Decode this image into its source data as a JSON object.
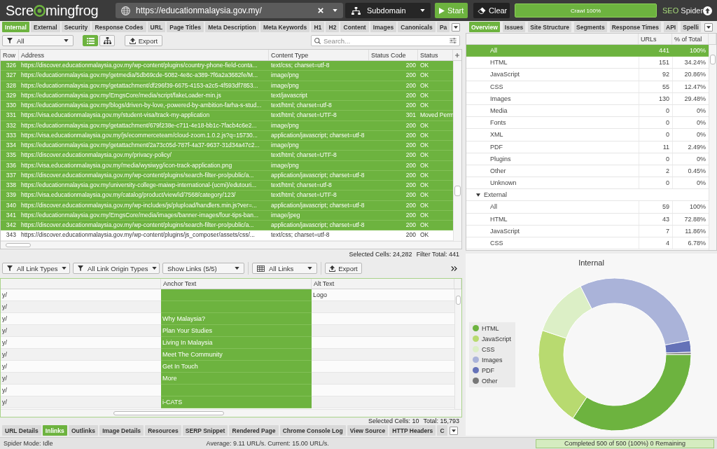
{
  "top_bar": {
    "logo": [
      "Scre",
      "mingfrog"
    ],
    "url_field": {
      "value": "https://educationmalaysia.gov.my/"
    },
    "mode_dropdown": {
      "value": "Subdomain"
    },
    "buttons": [
      {
        "kind": "start",
        "label": "Start"
      },
      {
        "kind": "clear",
        "label": "Clear"
      }
    ],
    "crawl_progress": {
      "label": "Crawl 100%",
      "level": 1
    },
    "product": [
      "SEO",
      "Spider"
    ]
  },
  "left_tabs": [
    {
      "label": "Internal",
      "selected": true
    },
    {
      "label": "External",
      "selected": false
    },
    {
      "label": "Security",
      "selected": false
    },
    {
      "label": "Response Codes",
      "selected": false
    },
    {
      "label": "URL",
      "selected": false
    },
    {
      "label": "Page Titles",
      "selected": false
    },
    {
      "label": "Meta Description",
      "selected": false
    },
    {
      "label": "Meta Keywords",
      "selected": false
    },
    {
      "label": "H1",
      "selected": false
    },
    {
      "label": "H2",
      "selected": false
    },
    {
      "label": "Content",
      "selected": false
    },
    {
      "label": "Images",
      "selected": false
    },
    {
      "label": "Canonicals",
      "selected": false
    },
    {
      "label": "Pa",
      "selected": false
    }
  ],
  "right_tabs": [
    {
      "label": "Overview",
      "selected": true
    },
    {
      "label": "Issues",
      "selected": false
    },
    {
      "label": "Site Structure",
      "selected": false
    },
    {
      "label": "Segments",
      "selected": false
    },
    {
      "label": "Response Times",
      "selected": false
    },
    {
      "label": "API",
      "selected": false
    },
    {
      "label": "Spelli",
      "selected": false
    }
  ],
  "main_toolbar": {
    "filter": {
      "value": "All"
    },
    "views": [
      {
        "kind": "list",
        "selected": true
      },
      {
        "kind": "tree",
        "selected": false
      }
    ],
    "export": "Export",
    "search": {
      "placeholder": "Search..."
    }
  },
  "main_table": {
    "columns": [
      "Row",
      "Address",
      "Content Type",
      "Status Code",
      "Status"
    ],
    "rows": [
      {
        "cells": [
          "326",
          "https://discover.educationmalaysia.gov.my/wp-content/plugins/country-phone-field-conta...",
          "text/css; charset=utf-8",
          "200",
          "OK"
        ],
        "selected": true
      },
      {
        "cells": [
          "327",
          "https://educationmalaysia.gov.my/getmedia/5db69cde-5082-4e8c-a389-7f6a2a3682fe/M...",
          "image/png",
          "200",
          "OK"
        ],
        "selected": true
      },
      {
        "cells": [
          "328",
          "https://educationmalaysia.gov.my/getattachment/df296f39-6675-4153-a2c5-4f593df7853...",
          "image/png",
          "200",
          "OK"
        ],
        "selected": true
      },
      {
        "cells": [
          "329",
          "https://educationmalaysia.gov.my/EmgsCore/media/script/fakeLoader-min.js",
          "text/javascript",
          "200",
          "OK"
        ],
        "selected": true
      },
      {
        "cells": [
          "330",
          "https://educationmalaysia.gov.my/blogs/driven-by-love,-powered-by-ambition-farha-s-stud...",
          "text/html; charset=utf-8",
          "200",
          "OK"
        ],
        "selected": true
      },
      {
        "cells": [
          "331",
          "https://visa.educationmalaysia.gov.my/student-visa/track-my-application",
          "text/html; charset=UTF-8",
          "301",
          "Moved Perm"
        ],
        "selected": true
      },
      {
        "cells": [
          "332",
          "https://educationmalaysia.gov.my/getattachment/679f238e-c711-4e18-bb1c-7facb4c6e2...",
          "image/png",
          "200",
          "OK"
        ],
        "selected": true
      },
      {
        "cells": [
          "333",
          "https://visa.educationmalaysia.gov.my/js/ecommerceteam/cloud-zoom.1.0.2.js?q=15730...",
          "application/javascript; charset=utf-8",
          "200",
          "OK"
        ],
        "selected": true
      },
      {
        "cells": [
          "334",
          "https://educationmalaysia.gov.my/getattachment/2a73c05d-787f-4a37-9637-31d34a47c2...",
          "image/png",
          "200",
          "OK"
        ],
        "selected": true
      },
      {
        "cells": [
          "335",
          "https://discover.educationmalaysia.gov.my/privacy-policy/",
          "text/html; charset=UTF-8",
          "200",
          "OK"
        ],
        "selected": true
      },
      {
        "cells": [
          "336",
          "https://visa.educationmalaysia.gov.my/media/wysiwyg/icon-track-application.png",
          "image/png",
          "200",
          "OK"
        ],
        "selected": true
      },
      {
        "cells": [
          "337",
          "https://discover.educationmalaysia.gov.my/wp-content/plugins/search-filter-pro/public/a...",
          "application/javascript; charset=utf-8",
          "200",
          "OK"
        ],
        "selected": true
      },
      {
        "cells": [
          "338",
          "https://educationmalaysia.gov.my/university-college-maiwp-international-(ucmi)/edutouri...",
          "text/html; charset=utf-8",
          "200",
          "OK"
        ],
        "selected": true
      },
      {
        "cells": [
          "339",
          "https://visa.educationmalaysia.gov.my/catalog/product/view/id/7568/category/123/",
          "text/html; charset=UTF-8",
          "200",
          "OK"
        ],
        "selected": true
      },
      {
        "cells": [
          "340",
          "https://discover.educationmalaysia.gov.my/wp-includes/js/plupload/handlers.min.js?ver=...",
          "application/javascript; charset=utf-8",
          "200",
          "OK"
        ],
        "selected": true
      },
      {
        "cells": [
          "341",
          "https://educationmalaysia.gov.my/EmgsCore/media/images/banner-images/four-tips-ban...",
          "image/jpeg",
          "200",
          "OK"
        ],
        "selected": true
      },
      {
        "cells": [
          "342",
          "https://discover.educationmalaysia.gov.my/wp-content/plugins/search-filter-pro/public/a...",
          "application/javascript; charset=utf-8",
          "200",
          "OK"
        ],
        "selected": true
      },
      {
        "cells": [
          "343",
          "https://discover.educationmalaysia.gov.my/wp-content/plugins/js_composer/assets/css/...",
          "text/css; charset=utf-8",
          "200",
          "OK"
        ],
        "selected": false
      }
    ]
  },
  "main_summary": [
    "Selected Cells: 24,282",
    "Filter Total: 441"
  ],
  "link_toolbar": {
    "dropdowns": [
      {
        "kind": "filter",
        "label": "All Link Types"
      },
      {
        "kind": "filter",
        "label": "All Link Origin Types"
      },
      {
        "kind": "plain",
        "label": "Show Links (5/5)"
      },
      {
        "kind": "columns",
        "label": "All Links"
      }
    ],
    "export": "Export"
  },
  "link_table": {
    "columns": [
      "",
      "Anchor Text",
      "Alt Text"
    ],
    "rows": [
      {
        "cells": [
          {
            "text": "y/",
            "selected": false
          },
          {
            "selected": true
          },
          {
            "text": "Logo",
            "selected": false
          }
        ]
      },
      {
        "cells": [
          {
            "text": "y/",
            "selected": false
          },
          {
            "selected": true
          },
          {
            "selected": false
          }
        ]
      },
      {
        "cells": [
          {
            "text": "y/",
            "selected": false
          },
          {
            "text": "Why Malaysia?",
            "selected": true
          },
          {
            "selected": false
          }
        ]
      },
      {
        "cells": [
          {
            "text": "y/",
            "selected": false
          },
          {
            "text": "Plan Your Studies",
            "selected": true
          },
          {
            "selected": false
          }
        ]
      },
      {
        "cells": [
          {
            "text": "y/",
            "selected": false
          },
          {
            "text": "Living In Malaysia",
            "selected": true
          },
          {
            "selected": false
          }
        ]
      },
      {
        "cells": [
          {
            "text": "y/",
            "selected": false
          },
          {
            "text": "Meet The Community",
            "selected": true
          },
          {
            "selected": false
          }
        ]
      },
      {
        "cells": [
          {
            "text": "y/",
            "selected": false
          },
          {
            "text": "Get In Touch",
            "selected": true
          },
          {
            "selected": false
          }
        ]
      },
      {
        "cells": [
          {
            "text": "y/",
            "selected": false
          },
          {
            "text": "More",
            "selected": true
          },
          {
            "selected": false
          }
        ]
      },
      {
        "cells": [
          {
            "text": "y/",
            "selected": false
          },
          {
            "selected": true
          },
          {
            "selected": false
          }
        ]
      },
      {
        "cells": [
          {
            "text": "y/",
            "selected": false
          },
          {
            "text": "i-CATS",
            "selected": true
          },
          {
            "selected": false
          }
        ]
      }
    ]
  },
  "link_summary": [
    "Selected Cells: 10",
    "Total: 15,793"
  ],
  "bottom_tabs": [
    {
      "label": "URL Details",
      "selected": false
    },
    {
      "label": "Inlinks",
      "selected": true
    },
    {
      "label": "Outlinks",
      "selected": false
    },
    {
      "label": "Image Details",
      "selected": false
    },
    {
      "label": "Resources",
      "selected": false
    },
    {
      "label": "SERP Snippet",
      "selected": false
    },
    {
      "label": "Rendered Page",
      "selected": false
    },
    {
      "label": "Chrome Console Log",
      "selected": false
    },
    {
      "label": "View Source",
      "selected": false
    },
    {
      "label": "HTTP Headers",
      "selected": false
    },
    {
      "label": "C",
      "selected": false
    }
  ],
  "overview": {
    "columns": [
      "URLs",
      "% of Total"
    ],
    "groups": [
      {
        "rows": [
          {
            "label": "All",
            "urls": "441",
            "share": "100%",
            "selected": true
          },
          {
            "label": "HTML",
            "urls": "151",
            "share": "34.24%",
            "selected": false
          },
          {
            "label": "JavaScript",
            "urls": "92",
            "share": "20.86%",
            "selected": false
          },
          {
            "label": "CSS",
            "urls": "55",
            "share": "12.47%",
            "selected": false
          },
          {
            "label": "Images",
            "urls": "130",
            "share": "29.48%",
            "selected": false
          },
          {
            "label": "Media",
            "urls": "0",
            "share": "0%",
            "selected": false
          },
          {
            "label": "Fonts",
            "urls": "0",
            "share": "0%",
            "selected": false
          },
          {
            "label": "XML",
            "urls": "0",
            "share": "0%",
            "selected": false
          },
          {
            "label": "PDF",
            "urls": "11",
            "share": "2.49%",
            "selected": false
          },
          {
            "label": "Plugins",
            "urls": "0",
            "share": "0%",
            "selected": false
          },
          {
            "label": "Other",
            "urls": "2",
            "share": "0.45%",
            "selected": false
          },
          {
            "label": "Unknown",
            "urls": "0",
            "share": "0%",
            "selected": false
          }
        ]
      },
      {
        "label": "External",
        "expanded": true,
        "rows": [
          {
            "label": "All",
            "urls": "59",
            "share": "100%",
            "selected": false
          },
          {
            "label": "HTML",
            "urls": "43",
            "share": "72.88%",
            "selected": false
          },
          {
            "label": "JavaScript",
            "urls": "7",
            "share": "11.86%",
            "selected": false
          },
          {
            "label": "CSS",
            "urls": "4",
            "share": "6.78%",
            "selected": false
          }
        ]
      }
    ]
  },
  "chart": {
    "chart_data": {
      "type": "donut",
      "title": "Internal",
      "categories": [
        "HTML",
        "JavaScript",
        "CSS",
        "Images",
        "PDF",
        "Other"
      ],
      "values": [
        34.24,
        20.86,
        12.47,
        29.48,
        2.49,
        0.45
      ],
      "colors": [
        "#6db33f",
        "#b8da70",
        "#dcefc6",
        "#aab3d9",
        "#6572b8",
        "#777777"
      ]
    }
  },
  "status_bar": {
    "mode": "Spider Mode: Idle",
    "speed": "Average: 9.11 URL/s. Current: 15.00 URL/s.",
    "progress": {
      "label": "Completed 500 of 500 (100%) 0 Remaining",
      "level": 1
    }
  }
}
